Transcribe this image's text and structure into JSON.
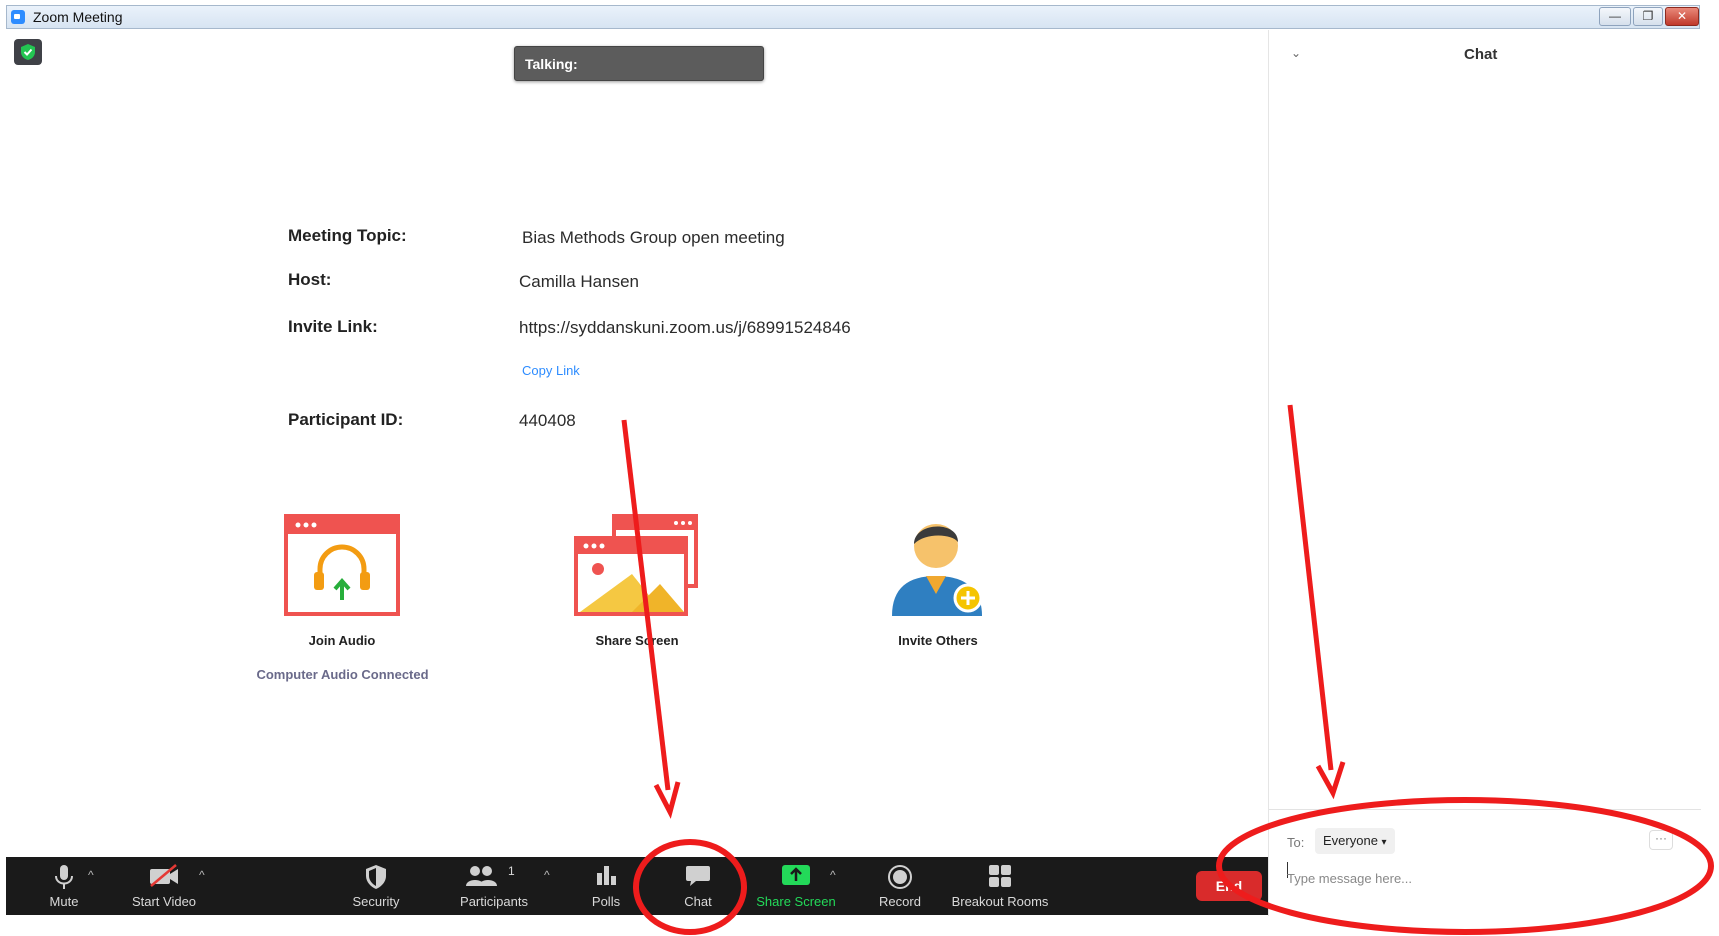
{
  "window": {
    "title": "Zoom Meeting",
    "buttons": {
      "minimize": "—",
      "restore": "❐",
      "close": "✕"
    }
  },
  "stage": {
    "talking_label": "Talking:",
    "info": {
      "topic_label": "Meeting Topic:",
      "topic_value": "Bias Methods Group open meeting",
      "host_label": "Host:",
      "host_value": "Camilla Hansen",
      "invite_label": "Invite Link:",
      "invite_value": "https://syddanskuni.zoom.us/j/68991524846",
      "copy_link": "Copy Link",
      "participant_label": "Participant ID:",
      "participant_value": "440408"
    },
    "actions": {
      "join_audio": "Join Audio",
      "audio_status": "Computer Audio Connected",
      "share_screen": "Share Screen",
      "invite_others": "Invite Others"
    }
  },
  "toolbar": {
    "mute": "Mute",
    "start_video": "Start Video",
    "security": "Security",
    "participants": "Participants",
    "participants_count": "1",
    "polls": "Polls",
    "chat": "Chat",
    "share_screen": "Share Screen",
    "record": "Record",
    "breakout_rooms": "Breakout Rooms",
    "end": "End",
    "caret": "^"
  },
  "chat_panel": {
    "title": "Chat",
    "to_label": "To:",
    "recipient": "Everyone",
    "more": "···",
    "placeholder": "Type message here..."
  },
  "colors": {
    "toolbar_bg": "#1a1a1a",
    "share_green": "#23d959",
    "end_red": "#d92b2b",
    "annotation_red": "#ee1c1c",
    "link_blue": "#2d8cff"
  }
}
